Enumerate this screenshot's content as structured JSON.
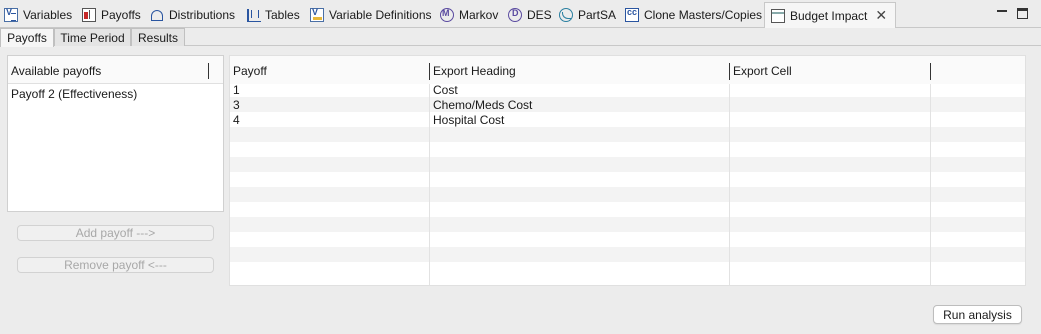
{
  "view_tabs": [
    {
      "label": "Variables",
      "icon": "variables-icon"
    },
    {
      "label": "Payoffs",
      "icon": "payoffs-icon"
    },
    {
      "label": "Distributions",
      "icon": "distributions-icon"
    },
    {
      "label": "Tables",
      "icon": "tables-icon"
    },
    {
      "label": "Variable Definitions",
      "icon": "variable-definitions-icon"
    },
    {
      "label": "Markov",
      "icon": "markov-icon"
    },
    {
      "label": "DES",
      "icon": "des-icon"
    },
    {
      "label": "PartSA",
      "icon": "partsa-icon"
    },
    {
      "label": "Clone Masters/Copies",
      "icon": "clone-icon"
    },
    {
      "label": "Budget Impact",
      "icon": "budget-impact-icon"
    }
  ],
  "active_view_tab": "Budget Impact",
  "inner_tabs": [
    "Payoffs",
    "Time Period",
    "Results"
  ],
  "active_inner_tab": "Payoffs",
  "available": {
    "header": "Available payoffs",
    "items": [
      "Payoff 2 (Effectiveness)"
    ]
  },
  "buttons": {
    "add": "Add payoff   --->",
    "remove": "Remove payoff <---",
    "run": "Run analysis"
  },
  "grid": {
    "headers": [
      "Payoff",
      "Export Heading",
      "Export Cell"
    ],
    "rows": [
      {
        "payoff": "1",
        "heading": "Cost",
        "cell": ""
      },
      {
        "payoff": "3",
        "heading": "Chemo/Meds Cost",
        "cell": ""
      },
      {
        "payoff": "4",
        "heading": "Hospital Cost",
        "cell": ""
      }
    ]
  }
}
